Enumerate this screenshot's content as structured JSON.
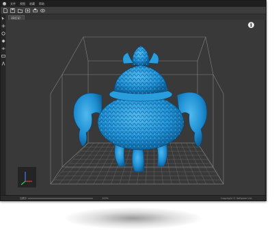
{
  "app": {
    "menu_items": [
      "文件",
      "视图",
      "收藏",
      "帮助"
    ]
  },
  "tabs": [
    {
      "label": "3D打印"
    }
  ],
  "viewport": {
    "info_label": "i",
    "model_color": "#1f8fd3",
    "grid_color": "#8a8a8a"
  },
  "status": {
    "left_text": "加载中",
    "center_text": "100%",
    "right_text": "Copyright © Software Ltd."
  },
  "icons": {
    "toolbar": [
      "new-icon",
      "save-icon",
      "open-icon",
      "export-icon",
      "print-icon",
      "view-icon"
    ],
    "leftbar": [
      "select-icon",
      "move-icon",
      "rotate-icon",
      "scale-icon",
      "cut-icon",
      "measure-icon",
      "support-icon"
    ]
  }
}
